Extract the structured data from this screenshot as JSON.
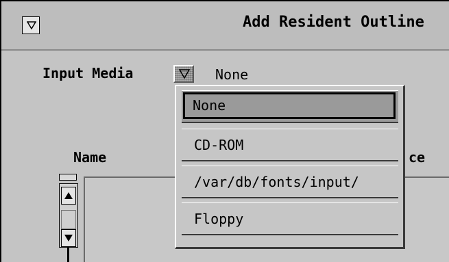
{
  "window": {
    "title": "Add Resident Outline",
    "menu_icon": "triangle-down-icon"
  },
  "form": {
    "input_media_label": "Input Media",
    "abbrev_menu_icon": "triangle-down-icon",
    "input_media_value": "None",
    "name_column_label": "Name",
    "source_column_label": "ce"
  },
  "dropdown": {
    "selected": "None",
    "items": [
      {
        "label": "None"
      },
      {
        "label": "CD-ROM"
      },
      {
        "label": "/var/db/fonts/input/"
      },
      {
        "label": "Floppy"
      }
    ]
  },
  "colors": {
    "panel": "#c4c4c4",
    "titlebar": "#bdbdbd",
    "selected_item": "#9a9a9a"
  }
}
